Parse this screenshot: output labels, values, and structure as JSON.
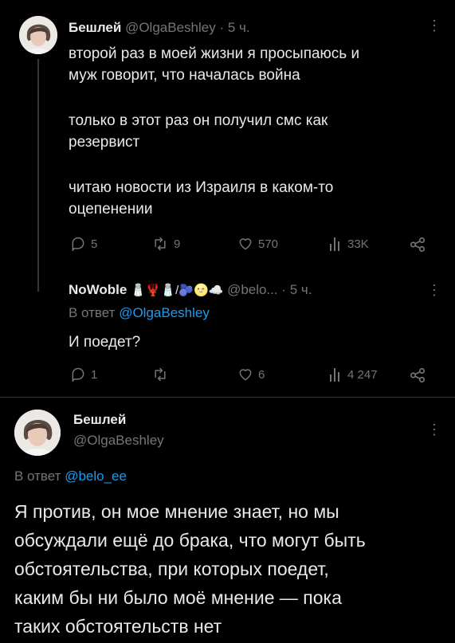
{
  "tweet1": {
    "name": "Бешлей",
    "handle": "@OlgaBeshley",
    "time": "· 5 ч.",
    "paragraphs": [
      "второй раз в моей жизни я просыпаюсь и",
      "муж говорит, что началась война",
      "только в этот раз он получил смс как",
      "резервист",
      "читаю новости из Израиля в каком-то",
      "оцепенении"
    ],
    "replies": "5",
    "retweets": "9",
    "likes": "570",
    "views": "33K"
  },
  "tweet2": {
    "name": "NoWoble",
    "emoji": "🧂🦞🧂/🫐🌝☁️",
    "handle": "@belo...",
    "time": "· 5 ч.",
    "reply_prefix": "В ответ",
    "reply_to": "@OlgaBeshley",
    "text": "И поедет?",
    "replies": "1",
    "likes": "6",
    "views": "4 247"
  },
  "tweet3": {
    "name": "Бешлей",
    "handle": "@OlgaBeshley",
    "reply_prefix": "В ответ",
    "reply_to": "@belo_ee",
    "lines": [
      "Я против, он мое мнение знает, но мы",
      "обсуждали ещё до брака, что могут быть",
      "обстоятельства, при которых поедет,",
      "каким бы ни было моё мнение — пока",
      "таких обстоятельств нет"
    ]
  }
}
